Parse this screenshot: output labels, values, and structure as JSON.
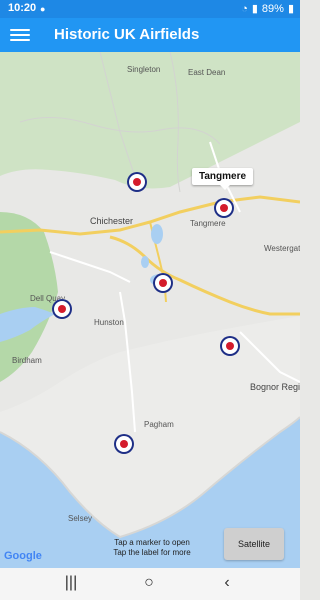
{
  "status": {
    "time": "10:20",
    "battery": "89%"
  },
  "appbar": {
    "title": "Historic UK Airfields",
    "menu_icon": "hamburger-menu-icon"
  },
  "map": {
    "place_names": [
      "Singleton",
      "East Dean",
      "Chichester",
      "Tangmere",
      "Westergate",
      "Dell Quay",
      "Hunston",
      "Birdham",
      "Bognor Regis",
      "Pagham",
      "Selsey"
    ],
    "selected_label": "Tangmere",
    "attribution": "Google",
    "hint_line1": "Tap a  marker  to open",
    "hint_line2": "Tap the label for more",
    "satellite_label": "Satellite"
  },
  "colors": {
    "appbar": "#2196f3",
    "statusbar": "#1e88e5",
    "roundel_blue": "#1e2f86",
    "roundel_red": "#d41c2c",
    "sea": "#a9cff2",
    "land": "#e8e8e6"
  }
}
